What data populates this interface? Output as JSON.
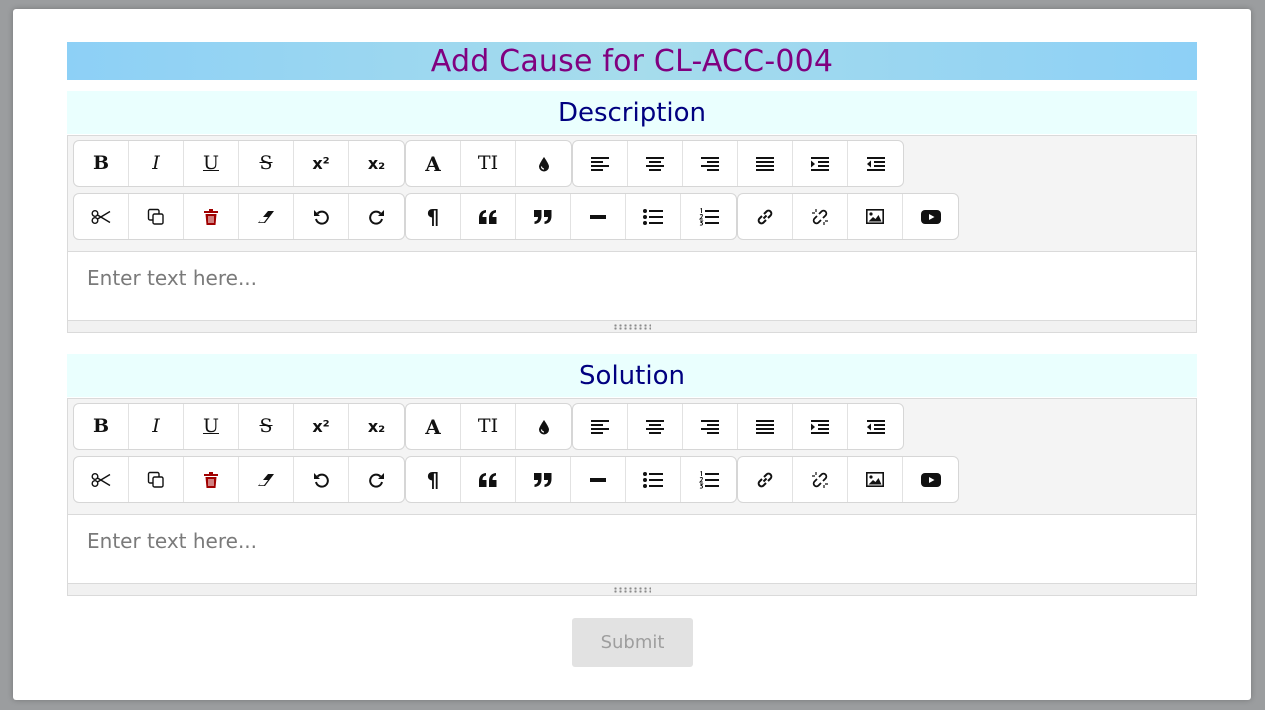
{
  "modal": {
    "title": "Add Cause for CL-ACC-004",
    "submit_label": "Submit"
  },
  "colors": {
    "title_text": "#800080",
    "heading_text": "#000080",
    "title_bg": "#8dd0f6",
    "heading_bg": "#eafffe",
    "delete_icon": "#a00000"
  },
  "sections": [
    {
      "heading": "Description",
      "placeholder": "Enter text here..."
    },
    {
      "heading": "Solution",
      "placeholder": "Enter text here..."
    }
  ],
  "toolbar": {
    "row1_groups": [
      [
        "bold-icon",
        "italic-icon",
        "underline-icon",
        "strikethrough-icon",
        "superscript-icon",
        "subscript-icon"
      ],
      [
        "font-icon",
        "font-size-icon",
        "color-drop-icon"
      ],
      [
        "align-left-icon",
        "align-center-icon",
        "align-right-icon",
        "align-justify-icon",
        "indent-icon",
        "outdent-icon"
      ]
    ],
    "row2_groups": [
      [
        "cut-icon",
        "copy-icon",
        "delete-icon",
        "eraser-icon",
        "undo-icon",
        "redo-icon"
      ],
      [
        "paragraph-icon",
        "quote-open-icon",
        "quote-close-icon",
        "horizontal-rule-icon",
        "bullet-list-icon",
        "numbered-list-icon"
      ],
      [
        "link-icon",
        "unlink-icon",
        "image-icon",
        "video-icon"
      ]
    ],
    "glyphs": {
      "bold": "B",
      "italic": "I",
      "underline": "U",
      "strike": "S",
      "superscript": "x²",
      "subscript": "x₂",
      "font": "A",
      "font_size": "TI",
      "paragraph": "¶"
    }
  }
}
